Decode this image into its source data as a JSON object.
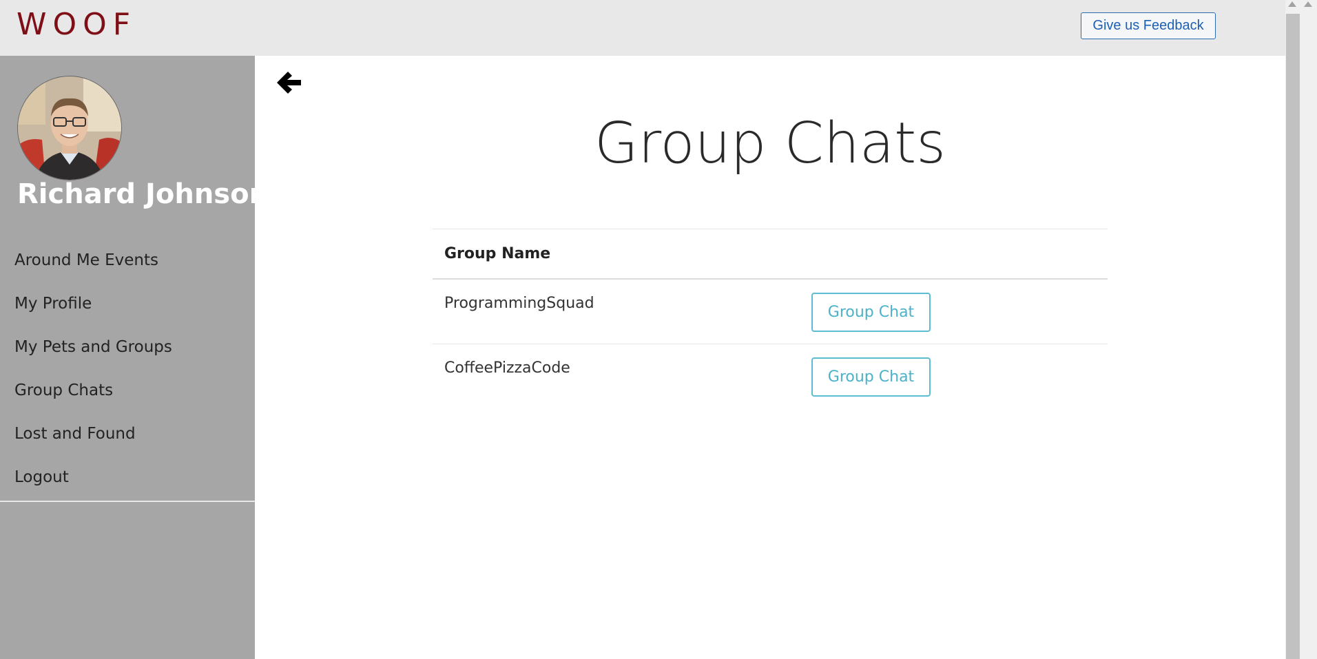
{
  "header": {
    "logo_text": "WOOF",
    "feedback_label": "Give us Feedback"
  },
  "sidebar": {
    "user_name": "Richard Johnson",
    "items": [
      {
        "label": "Around Me Events"
      },
      {
        "label": "My Profile"
      },
      {
        "label": "My Pets and Groups"
      },
      {
        "label": "Group Chats"
      },
      {
        "label": "Lost and Found"
      },
      {
        "label": "Logout"
      }
    ]
  },
  "main": {
    "title": "Group Chats",
    "table": {
      "column_header": "Group Name",
      "rows": [
        {
          "name": "ProgrammingSquad",
          "button": "Group Chat"
        },
        {
          "name": "CoffeePizzaCode",
          "button": "Group Chat"
        }
      ]
    }
  },
  "colors": {
    "brand": "#7e0f16",
    "sidebar_bg": "#a6a6a6",
    "header_bg": "#e8e8e8",
    "button_accent": "#5bbcd2"
  },
  "icons": {
    "back": "arrow-left-icon"
  }
}
